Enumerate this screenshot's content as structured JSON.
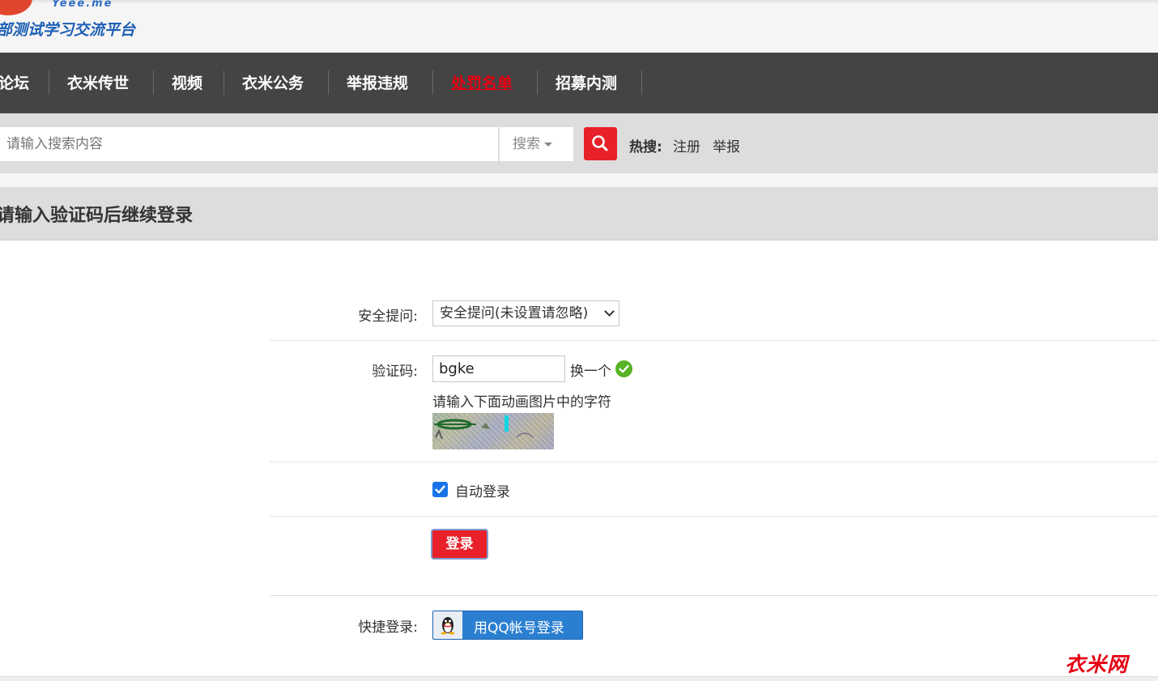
{
  "brand": {
    "site_sub": "Yeee.me",
    "site_title": "部测试学习交流平台",
    "watermark": "衣米网",
    "accent": "#e8202a"
  },
  "nav": {
    "items": [
      {
        "label": "论坛",
        "active": false
      },
      {
        "label": "衣米传世",
        "active": false
      },
      {
        "label": "视频",
        "active": false
      },
      {
        "label": "衣米公务",
        "active": false
      },
      {
        "label": "举报违规",
        "active": false
      },
      {
        "label": "处罚名单",
        "active": true
      },
      {
        "label": "招募内测",
        "active": false
      }
    ]
  },
  "search": {
    "placeholder": "请输入搜索内容",
    "type_label": "搜索",
    "button_icon": "search-icon",
    "hot_label": "热搜:",
    "hot_links": [
      "注册",
      "举报"
    ]
  },
  "page": {
    "title": "请输入验证码后继续登录"
  },
  "form": {
    "security_label": "安全提问:",
    "security_value": "安全提问(未设置请忽略)",
    "captcha_label": "验证码:",
    "captcha_value": "bgke",
    "captcha_change": "换一个",
    "captcha_hint": "请输入下面动画图片中的字符",
    "auto_login_label": "自动登录",
    "auto_login_checked": true,
    "login_button": "登录",
    "quick_login_label": "快捷登录:",
    "qq_button": "用QQ帐号登录"
  }
}
